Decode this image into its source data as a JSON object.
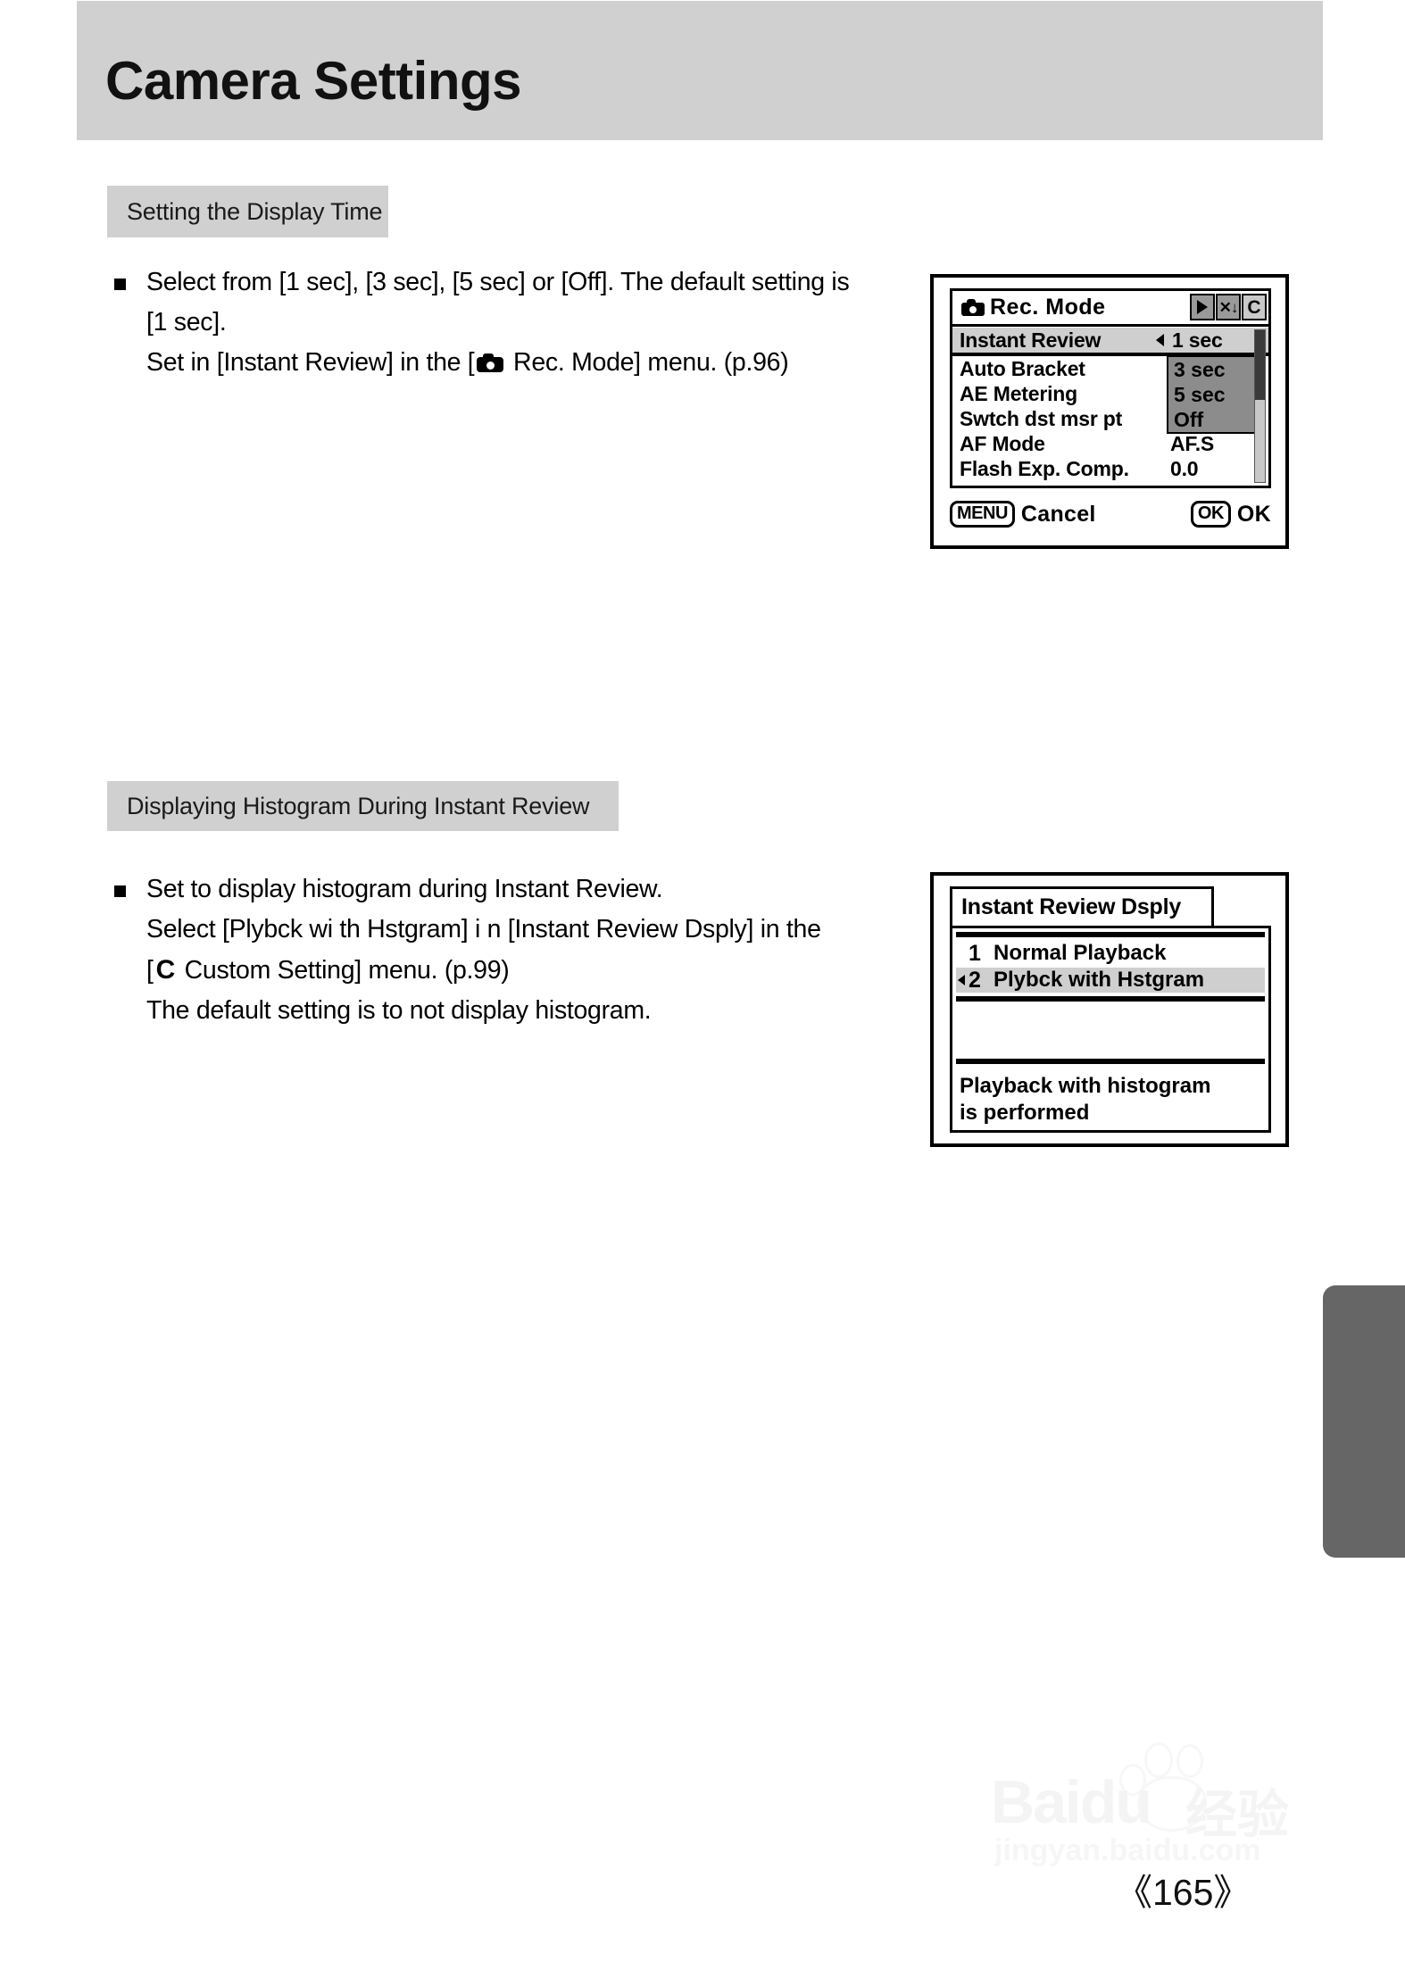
{
  "page": {
    "title": "Camera Settings",
    "number": "〈165〉",
    "number_display": "《165》"
  },
  "sections": [
    {
      "chip_label": "Setting the Display Time",
      "body": {
        "line1": "Select from [1 sec], [3 sec], [5 sec] or [Off]. The default setting is",
        "line2": "[1 sec].",
        "line3_before": "Set in [Instant Review] in the [",
        "line3_icon": "camera-icon",
        "line3_after": " Rec. Mode] menu. (p.96)"
      }
    },
    {
      "chip_label": "Displaying Histogram During Instant Review",
      "body": {
        "line1": "Set to display histogram during Instant Review.",
        "line2": "Select [Plybck wi th Hstgram] i n [Instant Review Dsply] in the",
        "line3_before": "[",
        "line3_icon": "C",
        "line3_after": " Custom Setting] menu. (p.99)",
        "line4": "The default setting is to not display histogram."
      }
    }
  ],
  "lcd_rec_mode": {
    "title": "Rec. Mode",
    "title_icon": "camera-icon",
    "tab_icons": [
      {
        "name": "playback-icon",
        "glyph": ""
      },
      {
        "name": "setup-wrench-icon",
        "glyph": "✕↓"
      },
      {
        "name": "custom-c-icon",
        "glyph": "C"
      }
    ],
    "rows": [
      {
        "label": "Instant Review",
        "value": "1 sec",
        "selected": true
      },
      {
        "label": "Auto Bracket",
        "value": "",
        "selected": false
      },
      {
        "label": "AE Metering",
        "value": "",
        "selected": false
      },
      {
        "label": "Swtch dst msr pt",
        "value": "",
        "selected": false
      },
      {
        "label": "AF Mode",
        "value": "AF.S",
        "selected": false
      },
      {
        "label": "Flash Exp. Comp.",
        "value": "0.0",
        "selected": false
      }
    ],
    "dropdown_options": [
      "3 sec",
      "5 sec",
      "Off"
    ],
    "footer": {
      "menu_button": "MENU",
      "menu_label": "Cancel",
      "ok_button": "OK",
      "ok_label": "OK"
    }
  },
  "lcd_review_dsply": {
    "title": "Instant Review Dsply",
    "options": [
      {
        "num": "1",
        "label": "Normal Playback",
        "selected": false
      },
      {
        "num": "2",
        "label": "Plybck with Hstgram",
        "selected": true
      }
    ],
    "description_line1": "Playback with histogram",
    "description_line2": "is performed"
  },
  "watermark": {
    "brand": "Baidu",
    "brand_cn": "经验",
    "url": "jingyan.baidu.com"
  },
  "colors": {
    "band_gray": "#d0d0d0",
    "tab_gray": "#666666",
    "lcd_highlight": "#cfcfcf",
    "dropdown_gray": "#8c8c8c"
  }
}
